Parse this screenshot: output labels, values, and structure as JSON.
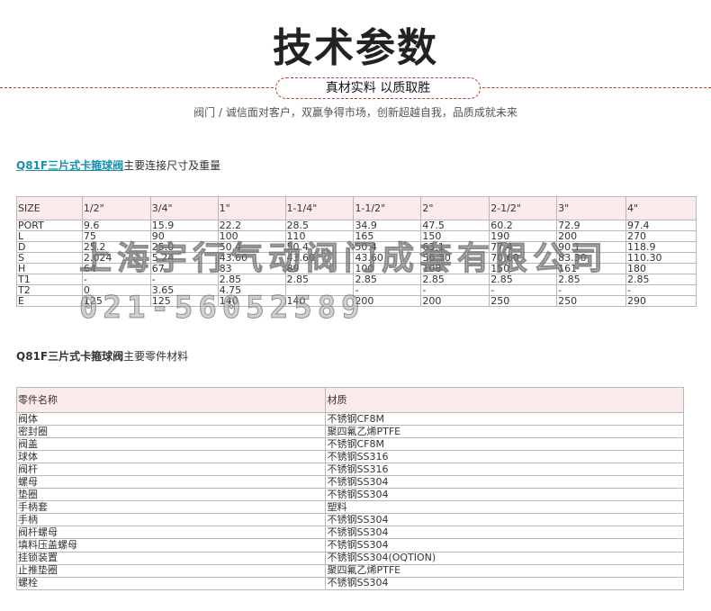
{
  "header": {
    "title": "技术参数",
    "pill": "真材实料  以质取胜",
    "slogan": "阀门 / 诚信面对客户，双赢争得市场，创新超越自我，品质成就未来"
  },
  "dimensions": {
    "title_link": "Q81F三片式卡箍球阀",
    "title_rest": "主要连接尺寸及重量",
    "header": [
      "SIZE",
      "1/2\"",
      "3/4\"",
      "1\"",
      "1-1/4\"",
      "1-1/2\"",
      "2\"",
      "2-1/2\"",
      "3\"",
      "4\""
    ],
    "rows": [
      [
        "PORT",
        "9.6",
        "15.9",
        "22.2",
        "28.5",
        "34.9",
        "47.5",
        "60.2",
        "72.9",
        "97.4"
      ],
      [
        "L",
        "75",
        "90",
        "100",
        "110",
        "165",
        "150",
        "190",
        "200",
        "270"
      ],
      [
        "D",
        "25.2",
        "25.0",
        "50.4",
        "50.4",
        "50.4",
        "63.1",
        "77.4",
        "90.1",
        "118.9"
      ],
      [
        "S",
        "2.024",
        "5.24",
        "43.60",
        "43.60",
        "43.60",
        "56.30",
        "70.60",
        "83.30",
        "110.30"
      ],
      [
        "H",
        "64",
        "67",
        "83",
        "89",
        "100",
        "108",
        "150",
        "161",
        "180"
      ],
      [
        "T1",
        "-",
        "-",
        "2.85",
        "2.85",
        "2.85",
        "2.85",
        "2.85",
        "2.85",
        "2.85"
      ],
      [
        "T2",
        "0",
        "3.65",
        "4.75",
        "",
        "-",
        "-",
        "-",
        "-",
        "-"
      ],
      [
        "E",
        "125",
        "125",
        "140",
        "140",
        "200",
        "200",
        "250",
        "250",
        "290"
      ]
    ]
  },
  "materials": {
    "title_bold": "Q81F三片式卡箍球阀",
    "title_rest": "主要零件材料",
    "header": [
      "零件名称",
      "材质"
    ],
    "rows": [
      [
        "阀体",
        "不锈钢CF8M"
      ],
      [
        "密封圈",
        "聚四氟乙烯PTFE"
      ],
      [
        "阀盖",
        "不锈钢CF8M"
      ],
      [
        "球体",
        "不锈钢SS316"
      ],
      [
        "阀杆",
        "不锈钢SS316"
      ],
      [
        "螺母",
        "不锈钢SS304"
      ],
      [
        "垫圈",
        "不锈钢SS304"
      ],
      [
        "手柄套",
        "塑料"
      ],
      [
        "手柄",
        "不锈钢SS304"
      ],
      [
        "阀杆螺母",
        "不锈钢SS304"
      ],
      [
        "填料压盖螺母",
        "不锈钢SS304"
      ],
      [
        "挂锁装置",
        "不锈钢SS304(OQTION)"
      ],
      [
        "止推垫圈",
        "聚四氟乙烯PTFE"
      ],
      [
        "螺栓",
        "不锈钢SS304"
      ]
    ]
  },
  "watermark": {
    "company": "上海宇行气动阀门成套有限公司",
    "phone": "021-56052589"
  }
}
